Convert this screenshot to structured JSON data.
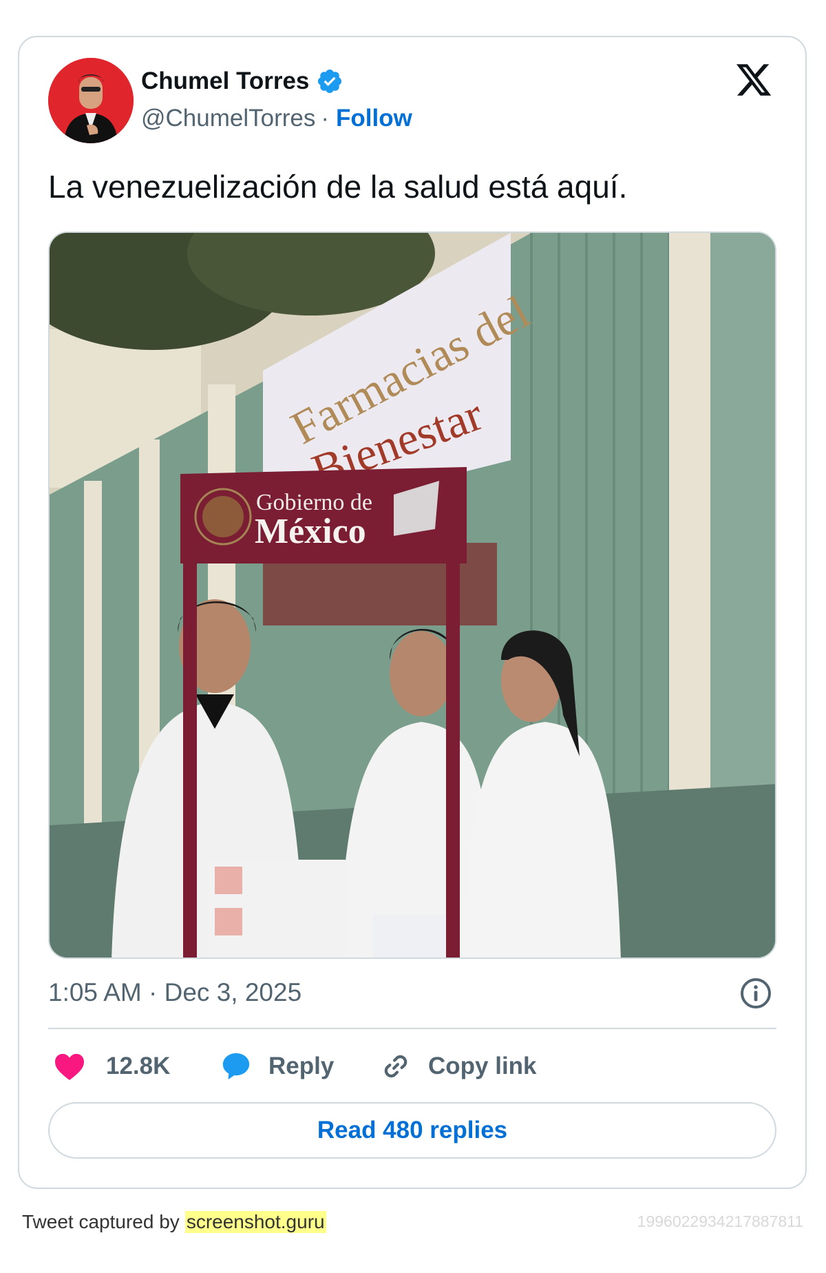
{
  "author": {
    "name": "Chumel Torres",
    "handle": "@ChumelTorres",
    "separator": "·",
    "follow_label": "Follow",
    "verified": true
  },
  "tweet": {
    "text": "La venezuelización de la salud está aquí.",
    "timestamp": "1:05 AM · Dec 3, 2025"
  },
  "media": {
    "banner_text": "Farmacias del Bienestar",
    "sign_line1": "Gobierno de",
    "sign_line2": "México"
  },
  "actions": {
    "like_count": "12.8K",
    "reply_label": "Reply",
    "copy_label": "Copy link",
    "read_replies_label": "Read 480 replies"
  },
  "footer": {
    "captured_prefix": "Tweet captured by",
    "captured_site": "screenshot.guru",
    "tweet_id": "1996022934217887811"
  },
  "colors": {
    "accent": "#006fd6",
    "verified_blue": "#1d9bf0",
    "like_pink": "#f91880",
    "muted": "#536471",
    "border": "#cfd9de",
    "sign_maroon": "#7b1d33"
  },
  "icons": [
    "verified-badge-icon",
    "x-logo-icon",
    "info-icon",
    "heart-icon",
    "reply-bubble-icon",
    "link-icon"
  ]
}
